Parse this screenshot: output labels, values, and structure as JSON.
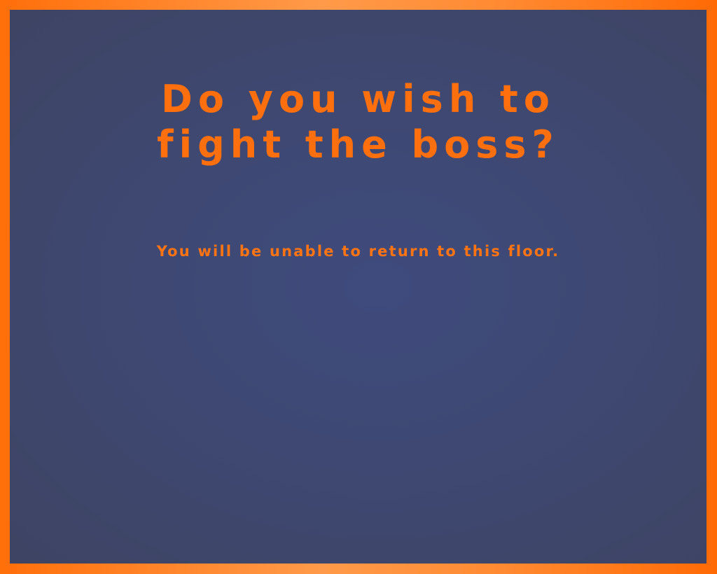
{
  "dialog": {
    "title_line1": "Do you wish to",
    "title_line2": "fight the boss?",
    "warning": "You will be unable to return to this floor."
  },
  "colors": {
    "frame": "#ff7a12",
    "panel": "#3e4872",
    "text": "#ff6f0d"
  }
}
